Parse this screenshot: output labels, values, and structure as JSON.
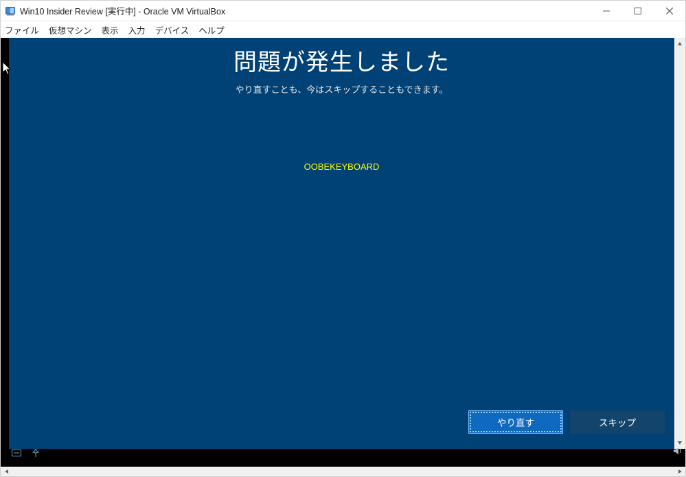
{
  "host_window": {
    "title": "Win10 Insider Review [実行中] - Oracle VM VirtualBox",
    "controls": {
      "minimize_icon": "minimize-icon",
      "maximize_icon": "maximize-icon",
      "close_icon": "close-icon"
    }
  },
  "menubar": {
    "items": [
      "ファイル",
      "仮想マシン",
      "表示",
      "入力",
      "デバイス",
      "ヘルプ"
    ]
  },
  "oobe": {
    "title": "問題が発生しました",
    "subtitle": "やり直すことも、今はスキップすることもできます。",
    "error_code": "OOBEKEYBOARD",
    "buttons": {
      "retry": "やり直す",
      "skip": "スキップ"
    }
  }
}
